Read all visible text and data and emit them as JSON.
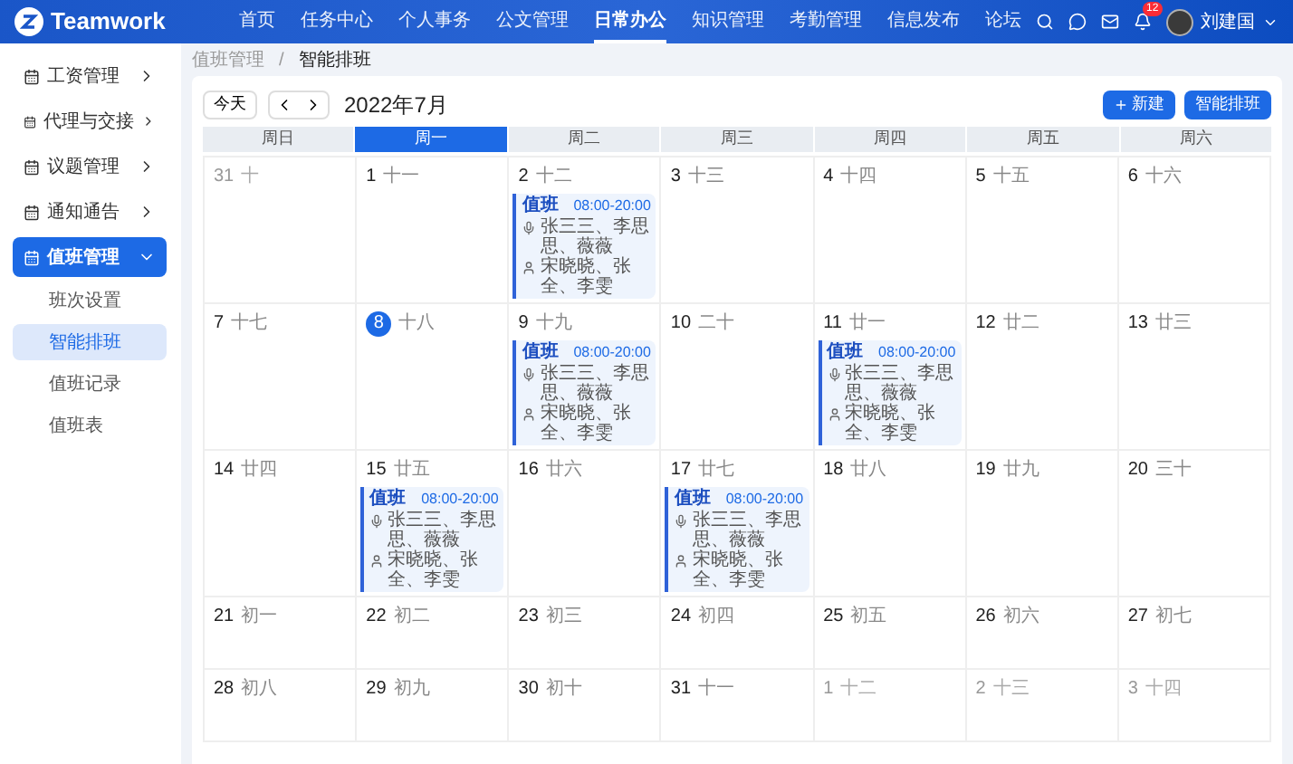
{
  "header": {
    "logo": "Teamwork",
    "nav": [
      {
        "label": "首页",
        "selected": false
      },
      {
        "label": "任务中心",
        "selected": false
      },
      {
        "label": "个人事务",
        "selected": false
      },
      {
        "label": "公文管理",
        "selected": false
      },
      {
        "label": "日常办公",
        "selected": true
      },
      {
        "label": "知识管理",
        "selected": false
      },
      {
        "label": "考勤管理",
        "selected": false
      },
      {
        "label": "信息发布",
        "selected": false
      },
      {
        "label": "论坛",
        "selected": false
      }
    ],
    "notification_count": "12",
    "user": "刘建国"
  },
  "sidebar": {
    "items": [
      {
        "label": "工资管理",
        "selected": false,
        "expanded": false
      },
      {
        "label": "代理与交接",
        "selected": false,
        "expanded": false
      },
      {
        "label": "议题管理",
        "selected": false,
        "expanded": false
      },
      {
        "label": "通知通告",
        "selected": false,
        "expanded": false
      },
      {
        "label": "值班管理",
        "selected": true,
        "expanded": true,
        "children": [
          {
            "label": "班次设置",
            "selected": false
          },
          {
            "label": "智能排班",
            "selected": true
          },
          {
            "label": "值班记录",
            "selected": false
          },
          {
            "label": "值班表",
            "selected": false
          }
        ]
      }
    ]
  },
  "breadcrumb": {
    "items": [
      "值班管理",
      "智能排班"
    ],
    "separator": "/"
  },
  "toolbar": {
    "today": "今天",
    "title": "2022年7月",
    "new_button": "新建",
    "smart_button": "智能排班"
  },
  "weekdays": [
    {
      "label": "周日",
      "selected": false
    },
    {
      "label": "周一",
      "selected": true
    },
    {
      "label": "周二",
      "selected": false
    },
    {
      "label": "周三",
      "selected": false
    },
    {
      "label": "周四",
      "selected": false
    },
    {
      "label": "周五",
      "selected": false
    },
    {
      "label": "周六",
      "selected": false
    }
  ],
  "weeks": [
    [
      {
        "date": "31",
        "lunar": "十",
        "other_month": true,
        "today": false
      },
      {
        "date": "1",
        "lunar": "十一",
        "other_month": false,
        "today": false
      },
      {
        "date": "2",
        "lunar": "十二",
        "other_month": false,
        "today": false,
        "events": [
          {
            "title": "值班",
            "time": "08:00-20:00",
            "leaders": "张三三、李思思、薇薇",
            "staff": "宋晓晓、张全、李雯"
          }
        ]
      },
      {
        "date": "3",
        "lunar": "十三",
        "other_month": false,
        "today": false
      },
      {
        "date": "4",
        "lunar": "十四",
        "other_month": false,
        "today": false
      },
      {
        "date": "5",
        "lunar": "十五",
        "other_month": false,
        "today": false
      },
      {
        "date": "6",
        "lunar": "十六",
        "other_month": false,
        "today": false
      }
    ],
    [
      {
        "date": "7",
        "lunar": "十七",
        "other_month": false,
        "today": false
      },
      {
        "date": "8",
        "lunar": "十八",
        "other_month": false,
        "today": true
      },
      {
        "date": "9",
        "lunar": "十九",
        "other_month": false,
        "today": false,
        "events": [
          {
            "title": "值班",
            "time": "08:00-20:00",
            "leaders": "张三三、李思思、薇薇",
            "staff": "宋晓晓、张全、李雯"
          }
        ]
      },
      {
        "date": "10",
        "lunar": "二十",
        "other_month": false,
        "today": false
      },
      {
        "date": "11",
        "lunar": "廿一",
        "other_month": false,
        "today": false,
        "events": [
          {
            "title": "值班",
            "time": "08:00-20:00",
            "leaders": "张三三、李思思、薇薇",
            "staff": "宋晓晓、张全、李雯"
          }
        ]
      },
      {
        "date": "12",
        "lunar": "廿二",
        "other_month": false,
        "today": false
      },
      {
        "date": "13",
        "lunar": "廿三",
        "other_month": false,
        "today": false
      }
    ],
    [
      {
        "date": "14",
        "lunar": "廿四",
        "other_month": false,
        "today": false
      },
      {
        "date": "15",
        "lunar": "廿五",
        "other_month": false,
        "today": false,
        "events": [
          {
            "title": "值班",
            "time": "08:00-20:00",
            "leaders": "张三三、李思思、薇薇",
            "staff": "宋晓晓、张全、李雯"
          }
        ]
      },
      {
        "date": "16",
        "lunar": "廿六",
        "other_month": false,
        "today": false
      },
      {
        "date": "17",
        "lunar": "廿七",
        "other_month": false,
        "today": false,
        "events": [
          {
            "title": "值班",
            "time": "08:00-20:00",
            "leaders": "张三三、李思思、薇薇",
            "staff": "宋晓晓、张全、李雯"
          }
        ]
      },
      {
        "date": "18",
        "lunar": "廿八",
        "other_month": false,
        "today": false
      },
      {
        "date": "19",
        "lunar": "廿九",
        "other_month": false,
        "today": false
      },
      {
        "date": "20",
        "lunar": "三十",
        "other_month": false,
        "today": false
      }
    ],
    [
      {
        "date": "21",
        "lunar": "初一",
        "other_month": false,
        "today": false
      },
      {
        "date": "22",
        "lunar": "初二",
        "other_month": false,
        "today": false
      },
      {
        "date": "23",
        "lunar": "初三",
        "other_month": false,
        "today": false
      },
      {
        "date": "24",
        "lunar": "初四",
        "other_month": false,
        "today": false
      },
      {
        "date": "25",
        "lunar": "初五",
        "other_month": false,
        "today": false
      },
      {
        "date": "26",
        "lunar": "初六",
        "other_month": false,
        "today": false
      },
      {
        "date": "27",
        "lunar": "初七",
        "other_month": false,
        "today": false
      }
    ],
    [
      {
        "date": "28",
        "lunar": "初八",
        "other_month": false,
        "today": false
      },
      {
        "date": "29",
        "lunar": "初九",
        "other_month": false,
        "today": false
      },
      {
        "date": "30",
        "lunar": "初十",
        "other_month": false,
        "today": false
      },
      {
        "date": "31",
        "lunar": "十一",
        "other_month": false,
        "today": false
      },
      {
        "date": "1",
        "lunar": "十二",
        "other_month": true,
        "today": false
      },
      {
        "date": "2",
        "lunar": "十三",
        "other_month": true,
        "today": false
      },
      {
        "date": "3",
        "lunar": "十四",
        "other_month": true,
        "today": false
      }
    ]
  ]
}
